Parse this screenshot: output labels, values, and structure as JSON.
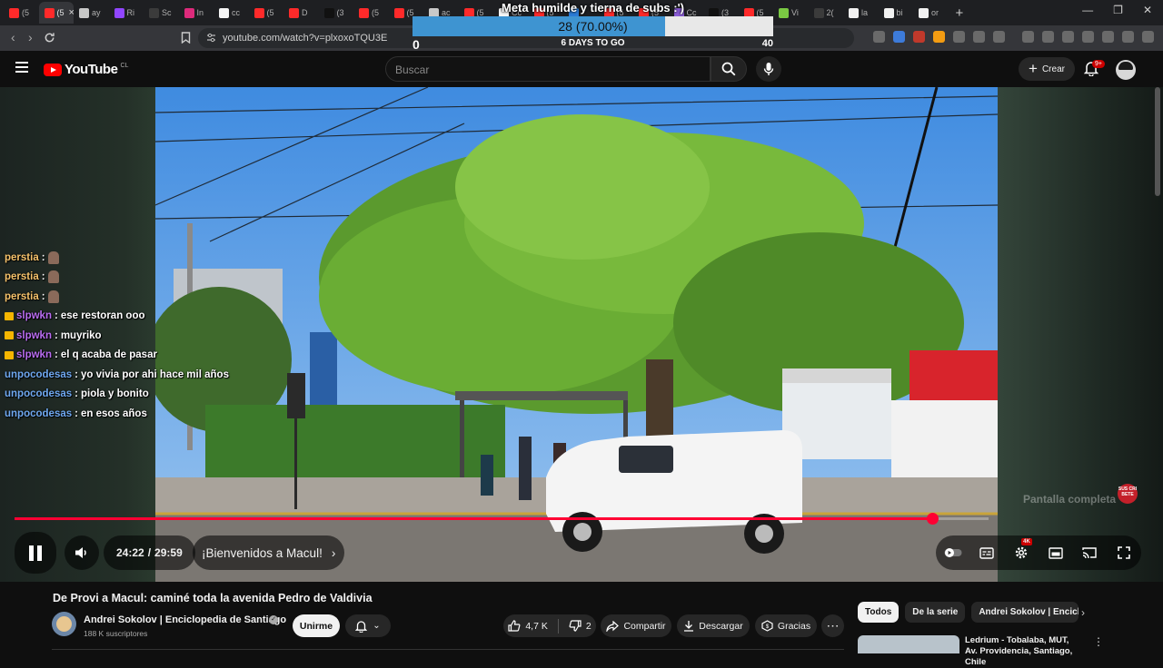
{
  "browser": {
    "tabs": [
      {
        "label": "(5",
        "color": "#ff2a2a"
      },
      {
        "label": "(5",
        "color": "#ff2a2a",
        "active": true
      },
      {
        "label": "ay",
        "color": "#c8c8c8"
      },
      {
        "label": "Ri",
        "color": "#9146ff"
      },
      {
        "label": "Sc",
        "color": "#3b3b3b"
      },
      {
        "label": "In",
        "color": "#dd2a7b"
      },
      {
        "label": "cc",
        "color": "#f5f5f5"
      },
      {
        "label": "(5",
        "color": "#ff2a2a"
      },
      {
        "label": "D",
        "color": "#ff2a2a"
      },
      {
        "label": "(3",
        "color": "#111111"
      },
      {
        "label": "(5",
        "color": "#ff2a2a"
      },
      {
        "label": "(5",
        "color": "#ff2a2a"
      },
      {
        "label": "ac",
        "color": "#c8c8c8"
      },
      {
        "label": "(5",
        "color": "#ff2a2a"
      },
      {
        "label": "Cc",
        "color": "#f5f5f5"
      },
      {
        "label": "(5",
        "color": "#ff2a2a"
      },
      {
        "label": "",
        "color": "#2b7bd6"
      },
      {
        "label": "(5",
        "color": "#ff2a2a"
      },
      {
        "label": "(5",
        "color": "#ff2a2a"
      },
      {
        "label": "Cc",
        "color": "#8a5cd6"
      },
      {
        "label": "(3",
        "color": "#111111"
      },
      {
        "label": "(5",
        "color": "#ff2a2a"
      },
      {
        "label": "Vi",
        "color": "#7ac943"
      },
      {
        "label": "2(",
        "color": "#3b3b3b"
      },
      {
        "label": "la",
        "color": "#f1f1f1"
      },
      {
        "label": "bi",
        "color": "#f1f1f1"
      },
      {
        "label": "or",
        "color": "#f1f1f1"
      }
    ],
    "url": "youtube.com/watch?v=plxoxoTQU3E"
  },
  "goal": {
    "title": "Meta humilde y tierna de subs :')",
    "count_text": "28 (70.00%)",
    "progress": 0.7,
    "min": "0",
    "max": "40",
    "days_left": "6 DAYS TO GO"
  },
  "header": {
    "logo_text": "YouTube",
    "region": "CL",
    "search_placeholder": "Buscar",
    "create_label": "Crear",
    "notifications_badge": "9+"
  },
  "chat": [
    {
      "user": "perstia",
      "message": "",
      "color": "#f5c26b",
      "badge": false,
      "emote": true
    },
    {
      "user": "perstia",
      "message": "",
      "color": "#f5c26b",
      "badge": false,
      "emote": true
    },
    {
      "user": "perstia",
      "message": "",
      "color": "#f5c26b",
      "badge": false,
      "emote": true
    },
    {
      "user": "slpwkn",
      "message": "ese restoran ooo",
      "color": "#b86cf0",
      "badge": true,
      "emote": false
    },
    {
      "user": "slpwkn",
      "message": "muyriko",
      "color": "#b86cf0",
      "badge": true,
      "emote": false
    },
    {
      "user": "slpwkn",
      "message": "el q acaba de pasar",
      "color": "#b86cf0",
      "badge": true,
      "emote": false
    },
    {
      "user": "unpocodesas",
      "message": "yo vivia por ahi hace mil años",
      "color": "#6fa8f0",
      "badge": false,
      "emote": false
    },
    {
      "user": "unpocodesas",
      "message": "piola y bonito",
      "color": "#6fa8f0",
      "badge": false,
      "emote": false
    },
    {
      "user": "unpocodesas",
      "message": "en esos años",
      "color": "#6fa8f0",
      "badge": false,
      "emote": false
    }
  ],
  "player": {
    "current_time": "24:22",
    "separator": "/",
    "duration": "29:59",
    "progress": 0.9423,
    "chapter": "¡Bienvenidos a Macul!",
    "quality_badge": "4K",
    "fullscreen_tooltip": "Pantalla completa",
    "sticker_text": "SUS CRI BETE"
  },
  "video": {
    "title": "De Provi a Macul: caminé toda la avenida Pedro de Valdivia",
    "channel_name": "Andrei Sokolov | Enciclopedia de Santiago",
    "subscribers": "188 K suscriptores",
    "join_label": "Unirme",
    "likes": "4,7 K",
    "dislikes": "2",
    "share_label": "Compartir",
    "download_label": "Descargar",
    "thanks_label": "Gracias"
  },
  "sidebar": {
    "chips": [
      "Todos",
      "De la serie",
      "Andrei Sokolov | Enciclopedia"
    ],
    "recommendation_title": "Ledrium - Tobalaba, MUT, Av. Providencia, Santiago, Chile"
  }
}
